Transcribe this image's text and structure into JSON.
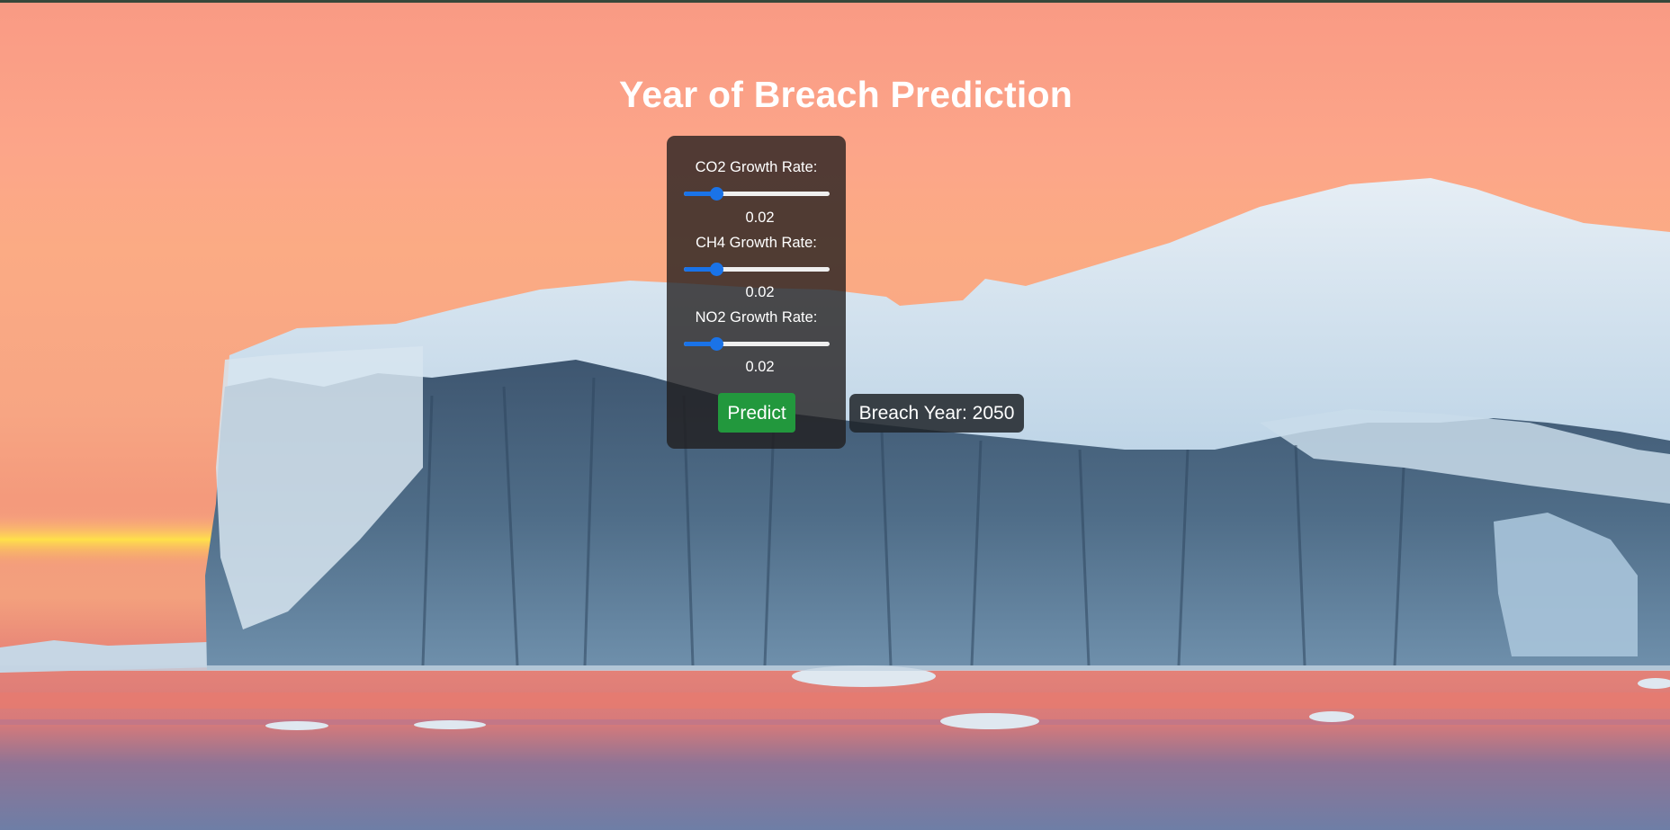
{
  "page": {
    "title": "Year of Breach Prediction"
  },
  "form": {
    "fields": [
      {
        "label": "CO2 Growth Rate:",
        "value": "0.02",
        "slider_fraction": 0.22
      },
      {
        "label": "CH4 Growth Rate:",
        "value": "0.02",
        "slider_fraction": 0.22
      },
      {
        "label": "NO2 Growth Rate:",
        "value": "0.02",
        "slider_fraction": 0.22
      }
    ],
    "predict_label": "Predict"
  },
  "result": {
    "text": "Breach Year: 2050"
  },
  "colors": {
    "accent": "#1a73e8",
    "button": "#22983d",
    "panel": "#201c1c",
    "sky": "#fca589",
    "ice": "#c8dcec"
  },
  "background": {
    "scene": "iceberg-sunset"
  }
}
